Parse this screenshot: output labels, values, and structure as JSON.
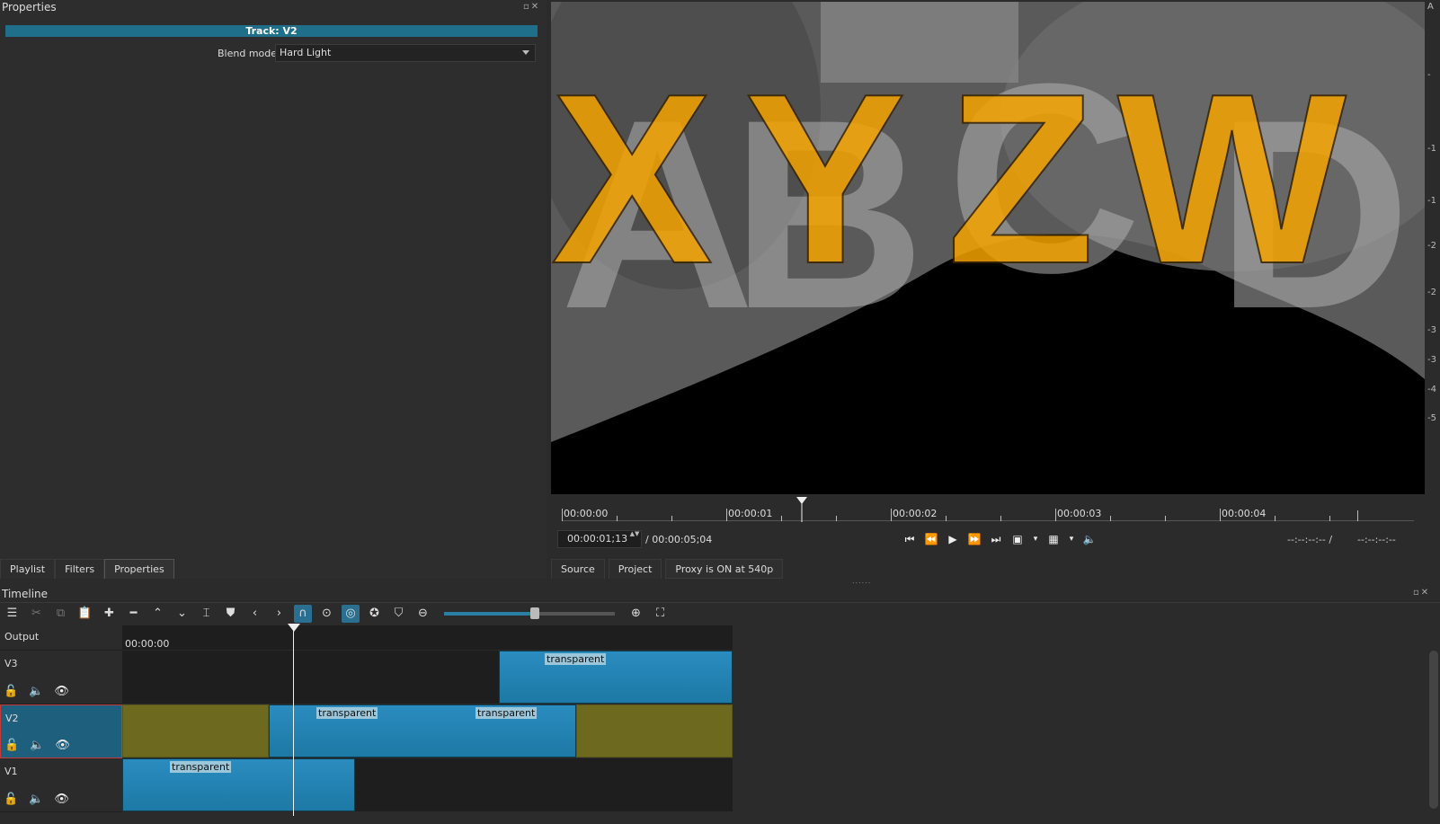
{
  "properties_panel": {
    "title": "Properties",
    "dock_buttons": "▫✕",
    "track_header": "Track: V2",
    "blend_mode_label": "Blend mode",
    "blend_mode_value": "Hard Light"
  },
  "left_tabs": [
    {
      "label": "Playlist"
    },
    {
      "label": "Filters"
    },
    {
      "label": "Properties"
    }
  ],
  "viewer": {
    "letters_back": [
      "A",
      "B",
      "C",
      "D"
    ],
    "letters_front": [
      "X",
      "Y",
      "Z",
      "W"
    ],
    "colors": {
      "front": "#f5a300",
      "back": "#b0b0b0"
    }
  },
  "meter_labels": [
    "A",
    "-",
    "-1",
    "-1",
    "-2",
    "-2",
    "-3",
    "-3",
    "-4",
    "-5"
  ],
  "ruler": {
    "labels": [
      "00:00:00",
      "00:00:01",
      "00:00:02",
      "00:00:03",
      "00:00:04"
    ]
  },
  "transport": {
    "timecode": "00:00:01;13",
    "spin": "▲▼",
    "duration": "/ 00:00:05;04",
    "buttons": [
      "⏮",
      "⏪",
      "▶",
      "⏩",
      "⏭",
      "▣",
      "▾",
      "▦",
      "▾",
      "🔈"
    ],
    "in_point": "--:--:--:-- /",
    "out_point": "--:--:--:--"
  },
  "right_tabs": [
    {
      "label": "Source"
    },
    {
      "label": "Project"
    }
  ],
  "proxy_badge": "Proxy is ON at 540p",
  "splitter": "......",
  "timeline": {
    "title": "Timeline",
    "dock_buttons": "▫✕",
    "ruler_start": "00:00:00",
    "toolbar": {
      "menu": "☰",
      "cut": "✂",
      "copy": "⧉",
      "paste": "📋",
      "append": "✚",
      "remove": "━",
      "lift": "⌃",
      "overwrite": "⌄",
      "split": "⌶",
      "marker": "⛊",
      "prev": "‹",
      "next": "›",
      "snap": "∩",
      "scrub": "⊙",
      "ripple": "◎",
      "ripple_all": "✪",
      "ripple_markers": "⛉",
      "zoom_out": "⊖",
      "zoom_in": "⊕",
      "zoom_fit": "⛶"
    },
    "zoom_level": 0.53,
    "tracks": [
      {
        "name": "Output"
      },
      {
        "name": "V3",
        "controls": [
          "🔓",
          "🔈",
          "👁"
        ]
      },
      {
        "name": "V2",
        "controls": [
          "🔓",
          "🔈",
          "👁"
        ]
      },
      {
        "name": "V1",
        "controls": [
          "🔓",
          "🔈",
          "👁"
        ]
      }
    ],
    "clips": {
      "v3": [
        "transparent"
      ],
      "v2": [
        "transparent",
        "transparent"
      ],
      "v1": [
        "transparent"
      ]
    }
  }
}
